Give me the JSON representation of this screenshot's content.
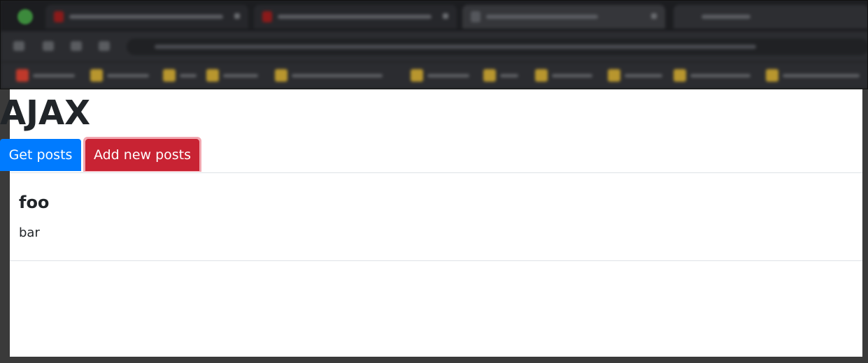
{
  "page": {
    "title": "AJAX",
    "buttons": {
      "get_posts": "Get posts",
      "add_new_posts": "Add new posts"
    },
    "posts": [
      {
        "title": "foo",
        "body": "bar"
      }
    ]
  },
  "colors": {
    "primary": "#007bff",
    "danger": "#c82333",
    "text": "#212529",
    "divider": "#dee2e6"
  }
}
